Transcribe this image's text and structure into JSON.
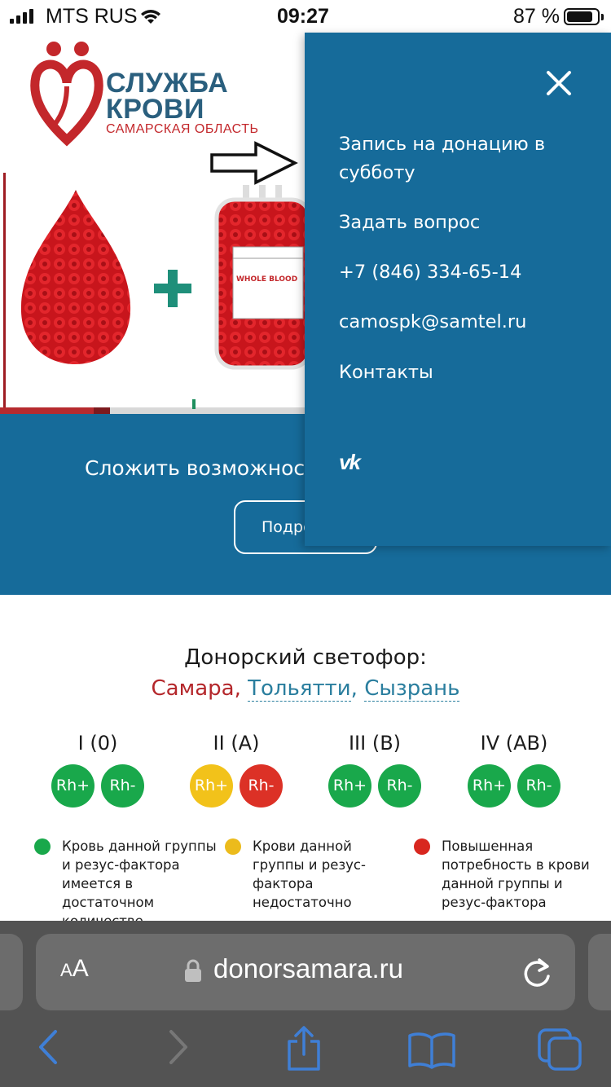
{
  "status_bar": {
    "carrier": "MTS RUS",
    "time": "09:27",
    "battery_percent": "87 %",
    "battery_level": 0.87,
    "signal_bars": 4
  },
  "logo": {
    "title_line1": "СЛУЖБА",
    "title_line2": "КРОВИ",
    "subtitle": "САМАРСКАЯ ОБЛАСТЬ"
  },
  "hero": {
    "bag_label": "WHOLE BLOOD",
    "band_text": "Сложить возможнос",
    "button_label": "Подро"
  },
  "traffic_light": {
    "title": "Донорский светофор:",
    "cities": [
      "Самара",
      "Тольятти",
      "Сызрань"
    ],
    "groups": [
      {
        "label": "I (0)",
        "rh_plus": "Rh+",
        "rh_minus": "Rh-",
        "plus_color": "#19a84b",
        "minus_color": "#19a84b"
      },
      {
        "label": "II (A)",
        "rh_plus": "Rh+",
        "rh_minus": "Rh-",
        "plus_color": "#f2c21a",
        "minus_color": "#dc3126"
      },
      {
        "label": "III (B)",
        "rh_plus": "Rh+",
        "rh_minus": "Rh-",
        "plus_color": "#19a84b",
        "minus_color": "#19a84b"
      },
      {
        "label": "IV (AB)",
        "rh_plus": "Rh+",
        "rh_minus": "Rh-",
        "plus_color": "#19a84b",
        "minus_color": "#19a84b"
      }
    ],
    "legend": [
      {
        "color": "#19a84b",
        "text": "Кровь данной группы и резус-фактора имеется в достаточном количестве"
      },
      {
        "color": "#ecbb1c",
        "text": "Крови данной группы и резус-фактора недостаточно"
      },
      {
        "color": "#d8271f",
        "text": "Повышенная потребность в крови данной группы и резус-фактора"
      }
    ]
  },
  "menu": {
    "items": [
      "Запись на донацию в субботу",
      "Задать вопрос",
      "+7 (846) 334-65-14",
      "camospk@samtel.ru",
      "Контакты"
    ],
    "social": "vk"
  },
  "browser": {
    "text_size_label": "AA",
    "url": "donorsamara.ru"
  },
  "colors": {
    "brand_blue": "#166b9a",
    "brand_red": "#c3272b",
    "green": "#19a84b",
    "yellow": "#f2c21a",
    "red": "#dc3126"
  },
  "icons": [
    "signal-icon",
    "wifi-icon",
    "battery-icon",
    "close-icon",
    "vk-icon",
    "lock-icon",
    "reload-icon",
    "back-icon",
    "forward-icon",
    "share-icon",
    "bookmarks-icon",
    "tabs-icon",
    "arrow-pointer-icon"
  ]
}
